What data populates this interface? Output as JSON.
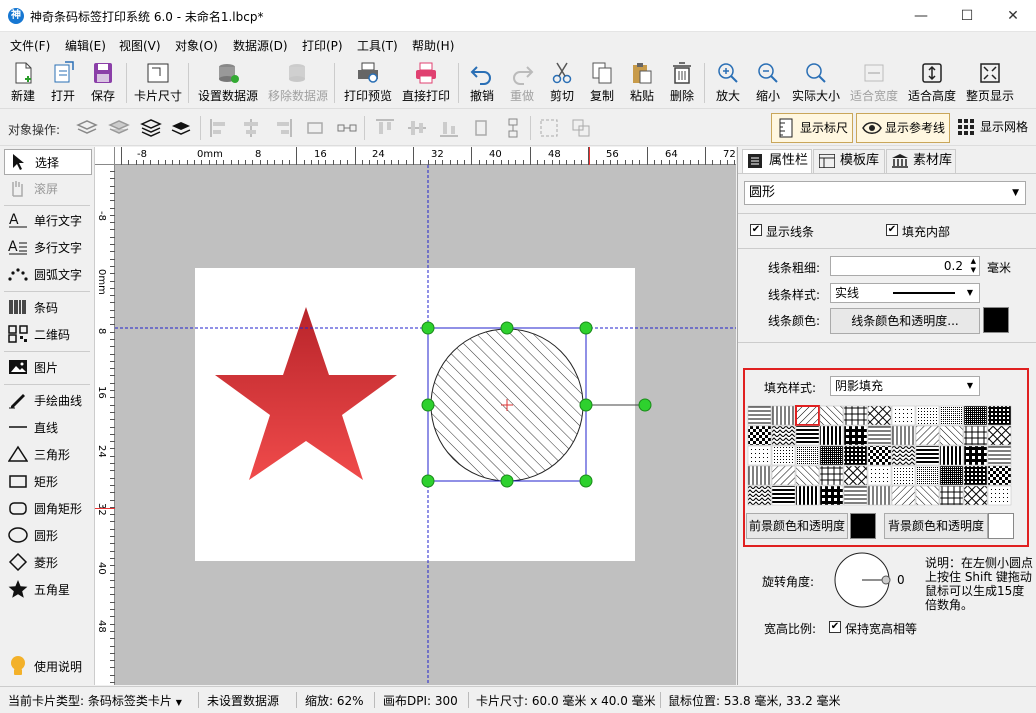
{
  "window": {
    "title": "神奇条码标签打印系统 6.0 - 未命名1.lbcp*",
    "app_icon": "神",
    "controls": {
      "minimize": "—",
      "maximize": "☐",
      "close": "✕"
    }
  },
  "menu": [
    "文件(F)",
    "编辑(E)",
    "视图(V)",
    "对象(O)",
    "数据源(D)",
    "打印(P)",
    "工具(T)",
    "帮助(H)"
  ],
  "toolbar": [
    {
      "label": "新建",
      "icon": "new-file-icon",
      "enabled": true
    },
    {
      "label": "打开",
      "icon": "open-icon",
      "enabled": true
    },
    {
      "label": "保存",
      "icon": "save-icon",
      "enabled": true
    },
    {
      "label": "卡片尺寸",
      "icon": "card-size-icon",
      "enabled": true
    },
    {
      "label": "设置数据源",
      "icon": "database-icon",
      "enabled": true
    },
    {
      "label": "移除数据源",
      "icon": "database-remove-icon",
      "enabled": false
    },
    {
      "label": "打印预览",
      "icon": "print-preview-icon",
      "enabled": true
    },
    {
      "label": "直接打印",
      "icon": "printer-icon",
      "enabled": true
    },
    {
      "label": "撤销",
      "icon": "undo-icon",
      "enabled": true
    },
    {
      "label": "重做",
      "icon": "redo-icon",
      "enabled": false
    },
    {
      "label": "剪切",
      "icon": "scissors-icon",
      "enabled": true
    },
    {
      "label": "复制",
      "icon": "copy-icon",
      "enabled": true
    },
    {
      "label": "粘贴",
      "icon": "paste-icon",
      "enabled": true
    },
    {
      "label": "删除",
      "icon": "trash-icon",
      "enabled": true
    },
    {
      "label": "放大",
      "icon": "zoom-in-icon",
      "enabled": true
    },
    {
      "label": "缩小",
      "icon": "zoom-out-icon",
      "enabled": true
    },
    {
      "label": "实际大小",
      "icon": "actual-size-icon",
      "enabled": true
    },
    {
      "label": "适合宽度",
      "icon": "fit-width-icon",
      "enabled": false
    },
    {
      "label": "适合高度",
      "icon": "fit-height-icon",
      "enabled": true
    },
    {
      "label": "整页显示",
      "icon": "full-page-icon",
      "enabled": true
    }
  ],
  "object_ops": {
    "label": "对象操作:",
    "show_ruler": "显示标尺",
    "show_guides": "显示参考线",
    "show_grid": "显示网格"
  },
  "tools": [
    {
      "label": "选择",
      "icon": "cursor-arrow-icon",
      "selected": true
    },
    {
      "label": "滚屏",
      "icon": "hand-icon",
      "disabled": true
    },
    {
      "label": "单行文字",
      "icon": "single-line-text-icon"
    },
    {
      "label": "多行文字",
      "icon": "multi-line-text-icon"
    },
    {
      "label": "圆弧文字",
      "icon": "arc-text-icon"
    },
    {
      "label": "条码",
      "icon": "barcode-icon"
    },
    {
      "label": "二维码",
      "icon": "qrcode-icon"
    },
    {
      "label": "图片",
      "icon": "image-icon"
    },
    {
      "label": "手绘曲线",
      "icon": "pen-icon"
    },
    {
      "label": "直线",
      "icon": "line-icon"
    },
    {
      "label": "三角形",
      "icon": "triangle-icon"
    },
    {
      "label": "矩形",
      "icon": "rectangle-icon"
    },
    {
      "label": "圆角矩形",
      "icon": "rounded-rectangle-icon"
    },
    {
      "label": "圆形",
      "icon": "circle-icon"
    },
    {
      "label": "菱形",
      "icon": "diamond-icon"
    },
    {
      "label": "五角星",
      "icon": "star-icon"
    },
    {
      "label": "使用说明",
      "icon": "lightbulb-icon"
    }
  ],
  "ruler": {
    "top_labels": [
      "-8",
      "0mm",
      "8",
      "16",
      "24",
      "32",
      "40",
      "48",
      "56",
      "64",
      "72"
    ],
    "left_labels": [
      "-8",
      "0mm",
      "8",
      "16",
      "24",
      "32",
      "40",
      "48"
    ]
  },
  "panel": {
    "tabs": [
      "属性栏",
      "模板库",
      "素材库"
    ],
    "object_type": "圆形",
    "show_line": "显示线条",
    "fill_inside": "填充内部",
    "line_width_label": "线条粗细:",
    "line_width_value": "0.2",
    "line_width_unit": "毫米",
    "line_style_label": "线条样式:",
    "line_style_value": "实线",
    "line_color_label": "线条颜色:",
    "line_color_button": "线条颜色和透明度...",
    "line_color": "#000000",
    "fill_style_label": "填充样式:",
    "fill_style_value": "阴影填充",
    "fg_button": "前景颜色和透明度",
    "fg_color": "#000000",
    "bg_button": "背景颜色和透明度",
    "bg_color": "#ffffff",
    "rotation_label": "旋转角度:",
    "rotation_value": "0",
    "note": "说明：在左侧小圆点上按住 Shift 键拖动鼠标可以生成15度倍数角。",
    "aspect_label": "宽高比例:",
    "keep_aspect": "保持宽高相等",
    "highlight_color": "#e02020"
  },
  "status": {
    "card_type": "当前卡片类型: 条码标签类卡片",
    "datasource": "未设置数据源",
    "zoom": "缩放: 62%",
    "dpi": "画布DPI: 300",
    "card_size": "卡片尺寸: 60.0 毫米 x 40.0 毫米",
    "mouse": "鼠标位置: 53.8 毫米, 33.2 毫米"
  },
  "canvas_colors": {
    "star_top": "#c0272d",
    "star_bottom": "#ee4a4a",
    "handle": "#2ed12e",
    "guide": "#2222cc"
  }
}
